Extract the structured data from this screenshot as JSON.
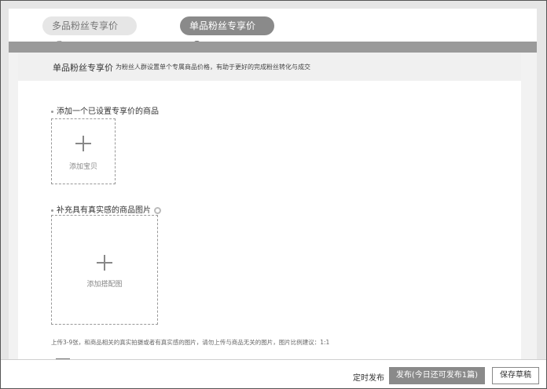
{
  "tabs": {
    "multi_label": "多品粉丝专享价",
    "single_label": "单品粉丝专享价",
    "help_glyph": "?"
  },
  "section": {
    "title": "单品粉丝专享价",
    "description": "为粉丝人群设置单个专属商品价格，有助于更好的完成粉丝转化与成交"
  },
  "product_field": {
    "label": "添加一个已设置专享价的商品",
    "upload_text": "添加宝贝"
  },
  "image_field": {
    "label": "补充具有真实感的商品图片",
    "upload_text": "添加搭配图",
    "hint": "上传3-9张，和商品相关的真实拍摄或者有真实感的图片，请勿上传与商品无关的图片，图片比例建议：1:1"
  },
  "footer": {
    "timed_label": "定时发布",
    "publish_label": "发布(今日还可发布1篇)",
    "draft_label": "保存草稿"
  },
  "colors": {
    "active_tab": "#8a8a8a",
    "inactive_tab": "#e6e6e6",
    "primary_button": "#8a8a8a"
  },
  "icons": {
    "help": "question-circle-icon",
    "info": "info-circle-icon",
    "add": "plus-icon"
  }
}
